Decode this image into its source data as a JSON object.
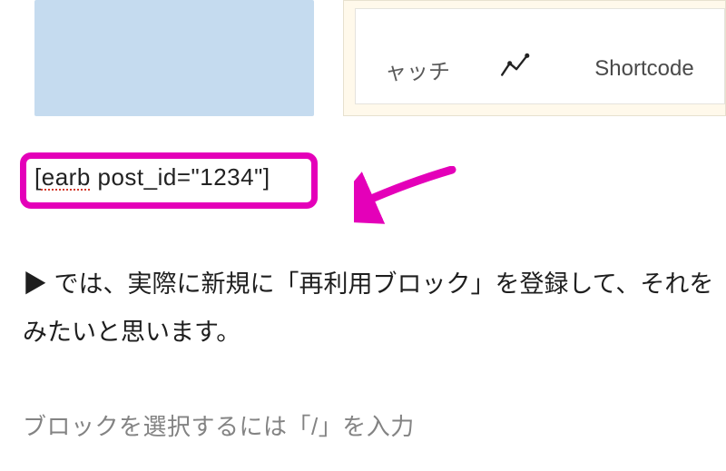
{
  "top": {
    "picker_item_1_label": "ャッチ",
    "picker_item_2_label": "Shortcode",
    "picker_stats_icon": "stats-icon"
  },
  "shortcode": {
    "raw": "[earb post_id=\"1234\"]",
    "misspelled_part": "earb",
    "rest_part": " post_id=\"1234\"]",
    "open_bracket": "["
  },
  "paragraph": {
    "line1": "▶ では、実際に新規に「再利用ブロック」を登録して、それを",
    "line2": "みたいと思います。"
  },
  "hint": {
    "text": "ブロックを選択するには「/」を入力"
  },
  "annotation": {
    "arrow_color": "#e400b9"
  }
}
